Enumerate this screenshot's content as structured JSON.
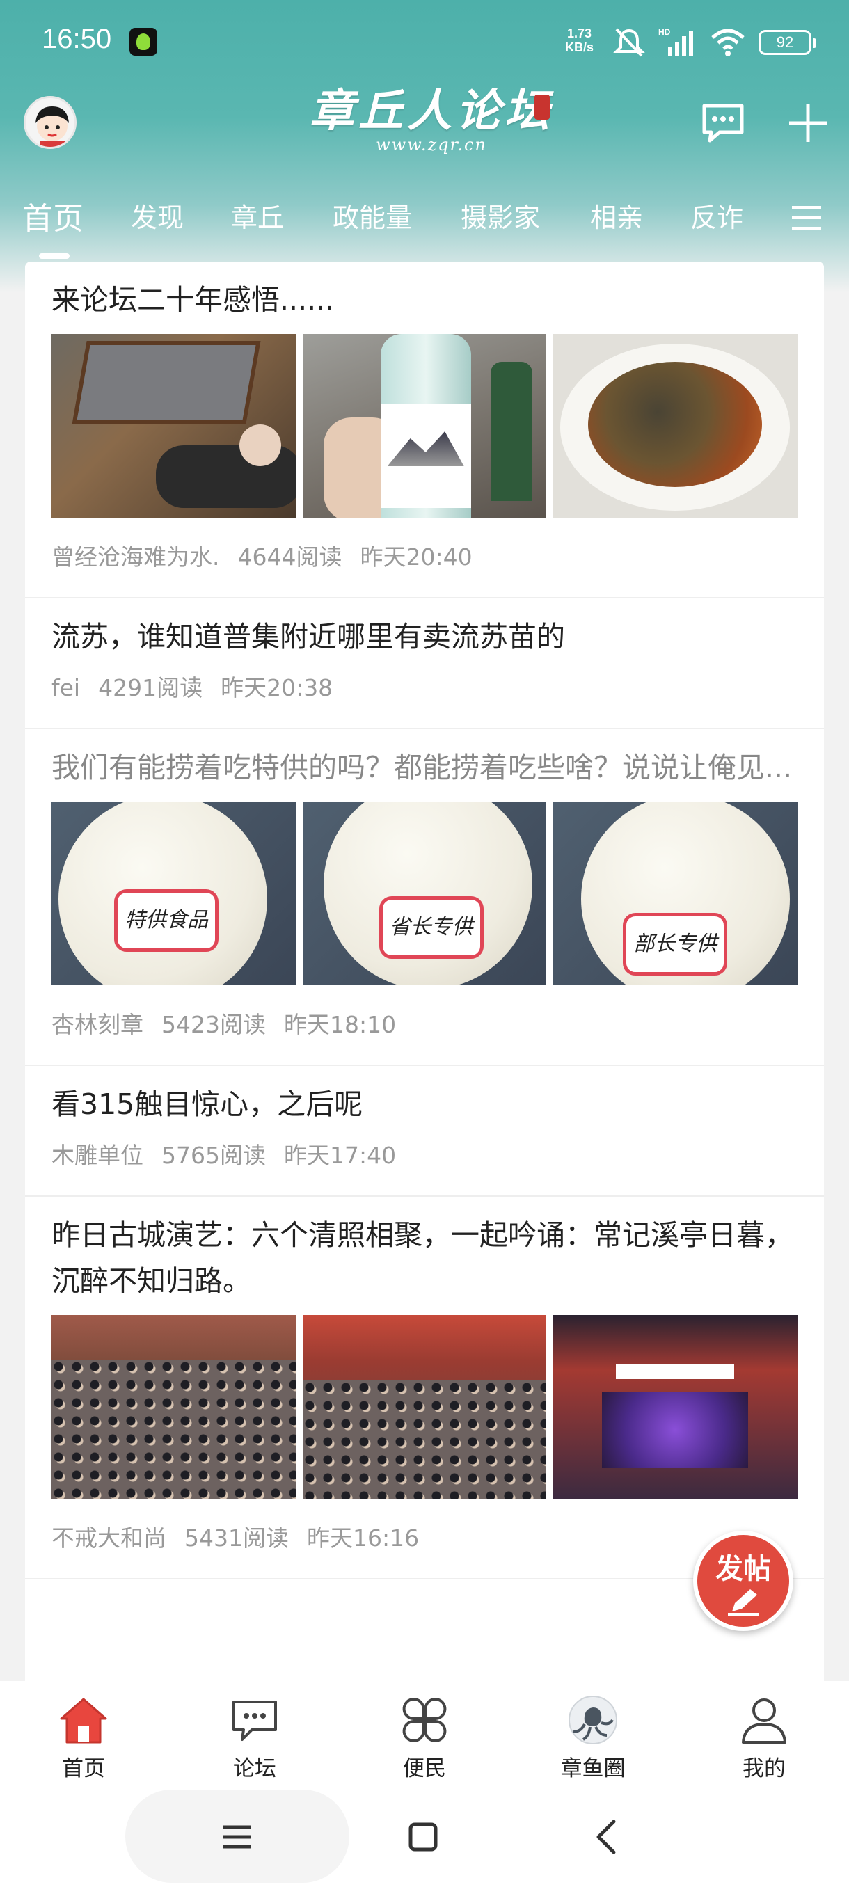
{
  "status_bar": {
    "time": "16:50",
    "net_speed_value": "1.73",
    "net_speed_unit": "KB/s",
    "battery": "92"
  },
  "header": {
    "logo_title": "章丘人论坛",
    "logo_url": "www.zqr.cn"
  },
  "tabs": [
    {
      "label": "首页",
      "active": true
    },
    {
      "label": "发现"
    },
    {
      "label": "章丘"
    },
    {
      "label": "政能量"
    },
    {
      "label": "摄影家"
    },
    {
      "label": "相亲"
    },
    {
      "label": "反诈"
    }
  ],
  "posts": [
    {
      "title": "来论坛二十年感悟......",
      "author": "曾经沧海难为水.",
      "reads": "4644阅读",
      "time": "昨天20:40"
    },
    {
      "title": "流苏，谁知道普集附近哪里有卖流苏苗的",
      "author": "fei",
      "reads": "4291阅读",
      "time": "昨天20:38"
    },
    {
      "title": "我们有能捞着吃特供的吗？都能捞着吃些啥？说说让俺见...",
      "author": "杏林刻章",
      "reads": "5423阅读",
      "time": "昨天18:10",
      "image_tags": [
        "特供食品",
        "省长专供",
        "部长专供"
      ]
    },
    {
      "title": "看315触目惊心，之后呢",
      "author": "木雕单位",
      "reads": "5765阅读",
      "time": "昨天17:40"
    },
    {
      "title": "昨日古城演艺：六个清照相聚，一起吟诵：常记溪亭日暮，沉醉不知归路。",
      "author": "不戒大和尚",
      "reads": "5431阅读",
      "time": "昨天16:16"
    }
  ],
  "fab": {
    "label": "发帖"
  },
  "bottom_nav": [
    {
      "label": "首页",
      "icon": "home-icon"
    },
    {
      "label": "论坛",
      "icon": "chat-icon"
    },
    {
      "label": "便民",
      "icon": "clover-icon"
    },
    {
      "label": "章鱼圈",
      "icon": "octopus-icon"
    },
    {
      "label": "我的",
      "icon": "person-icon"
    }
  ],
  "colors": {
    "header_teal": "#4db0aa",
    "accent_red": "#e04a3e",
    "meta_gray": "#999999"
  }
}
